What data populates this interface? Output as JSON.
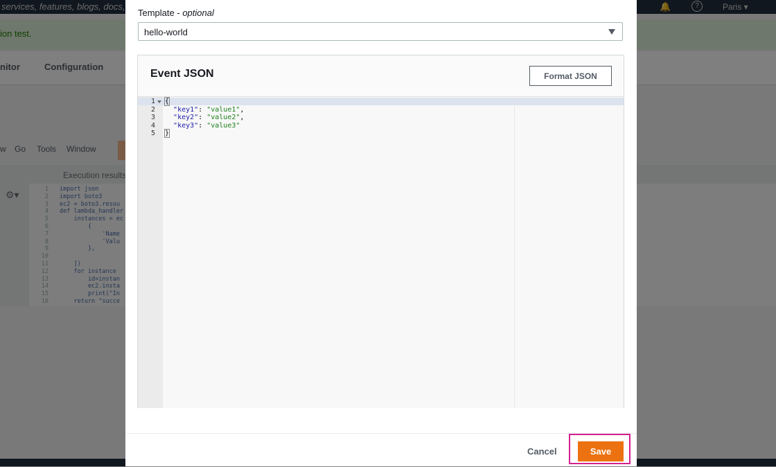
{
  "background": {
    "search_placeholder": "services, features, blogs, docs, a",
    "region": "Paris ▾",
    "flash_message": "ion test.",
    "tabs": [
      "nitor",
      "Configuration"
    ],
    "ide_menu": [
      "w",
      "Go",
      "Tools",
      "Window"
    ],
    "execution_results": "Execution results",
    "code_line_numbers": [
      "1",
      "2",
      "3",
      "4",
      "5",
      "6",
      "7",
      "8",
      "9",
      "10",
      "11",
      "12",
      "13",
      "14",
      "15",
      "16"
    ],
    "code_lines": [
      "import json",
      "import boto3",
      "ec2 = boto3.resou",
      "def lambda_handler",
      "    instances = ec",
      "        {",
      "            'Name",
      "            'Valu",
      "        },",
      "",
      "    ])",
      "    for instance",
      "        id=instan",
      "        ec2.insta",
      "        print(\"In",
      "    return \"succe"
    ]
  },
  "modal": {
    "template_label": "Template - ",
    "template_optional": "optional",
    "template_value": "hello-world",
    "event_json_title": "Event JSON",
    "format_json_label": "Format JSON",
    "editor_lines": [
      {
        "num": "1",
        "text": "{"
      },
      {
        "num": "2",
        "key": "\"key1\"",
        "value": "\"value1\"",
        "trail": ","
      },
      {
        "num": "3",
        "key": "\"key2\"",
        "value": "\"value2\"",
        "trail": ","
      },
      {
        "num": "4",
        "key": "\"key3\"",
        "value": "\"value3\"",
        "trail": ""
      },
      {
        "num": "5",
        "text": "}"
      }
    ],
    "cancel_label": "Cancel",
    "save_label": "Save"
  },
  "colors": {
    "primary_button": "#ec7211",
    "highlight_border": "#d6208f",
    "json_key": "#1a1aa6",
    "json_string": "#1a7f1a"
  },
  "icons": {
    "dropdown": "caret-down-icon",
    "fold": "fold-arrow-icon"
  }
}
